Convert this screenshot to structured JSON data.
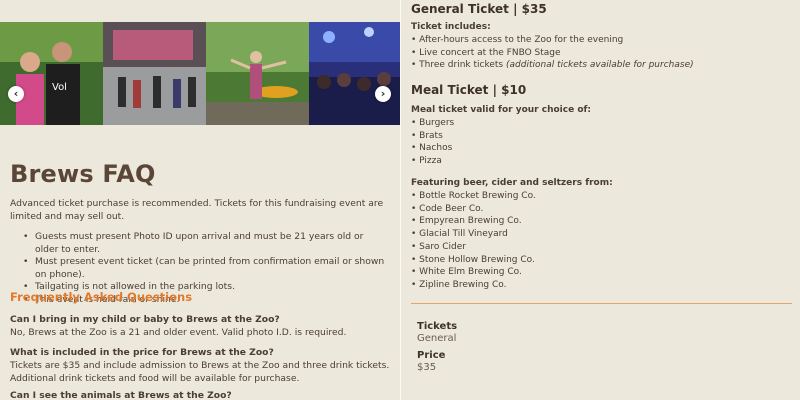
{
  "carousel": {
    "prev_label": "‹",
    "next_label": "›",
    "photos": [
      {
        "name": "photo-couple"
      },
      {
        "name": "photo-concert-stage"
      },
      {
        "name": "photo-woman-trees"
      },
      {
        "name": "photo-crowd-lights"
      }
    ]
  },
  "page": {
    "title": "Brews FAQ",
    "intro": "Advanced ticket purchase is recommended. Tickets for this fundraising event are limited and may sell out.",
    "rules": [
      "Guests must present Photo ID upon arrival and must be 21 years old or older to enter.",
      "Must present event ticket (can be printed from confirmation email or shown on phone).",
      "Tailgating is not allowed in the parking lots.",
      "This event is held rain or shine."
    ],
    "faq_heading": "Frequently Asked Questions",
    "faq": [
      {
        "q": "Can I bring in my child or baby to Brews at the Zoo?",
        "a": "No, Brews at the Zoo is a 21 and older event. Valid photo I.D. is required."
      },
      {
        "q": "What is included in the price for Brews at the Zoo?",
        "a": "Tickets are $35 and include admission to Brews at the Zoo and three drink tickets. Additional drink tickets and food will be available for purchase."
      },
      {
        "q": "Can I see the animals at Brews at the Zoo?",
        "a": ""
      }
    ]
  },
  "general_ticket": {
    "heading": "General Ticket | $35",
    "includes_label": "Ticket includes:",
    "items": [
      "After-hours access to the Zoo for the evening",
      "Live concert at the FNBO Stage",
      "Three drink tickets "
    ],
    "items_note": "(additional tickets available for purchase)"
  },
  "meal_ticket": {
    "heading": "Meal Ticket | $10",
    "valid_label": "Meal ticket valid for your choice of:",
    "items": [
      "Burgers",
      "Brats",
      "Nachos",
      "Pizza"
    ]
  },
  "featuring": {
    "label": "Featuring beer, cider and seltzers from:",
    "items": [
      "Bottle Rocket Brewing Co.",
      "Code Beer Co.",
      "Empyrean Brewing Co.",
      "Glacial Till Vineyard",
      "Saro Cider",
      "Stone Hollow Brewing Co.",
      "White Elm Brewing Co.",
      "Zipline Brewing Co."
    ]
  },
  "tickets_summary": {
    "tickets_label": "Tickets",
    "tickets_value": "General",
    "price_label": "Price",
    "price_value": "$35"
  },
  "colors": {
    "background": "#ede8dc",
    "accent": "#e07b2e",
    "heading": "#5a4636",
    "text": "#4a3d33"
  }
}
